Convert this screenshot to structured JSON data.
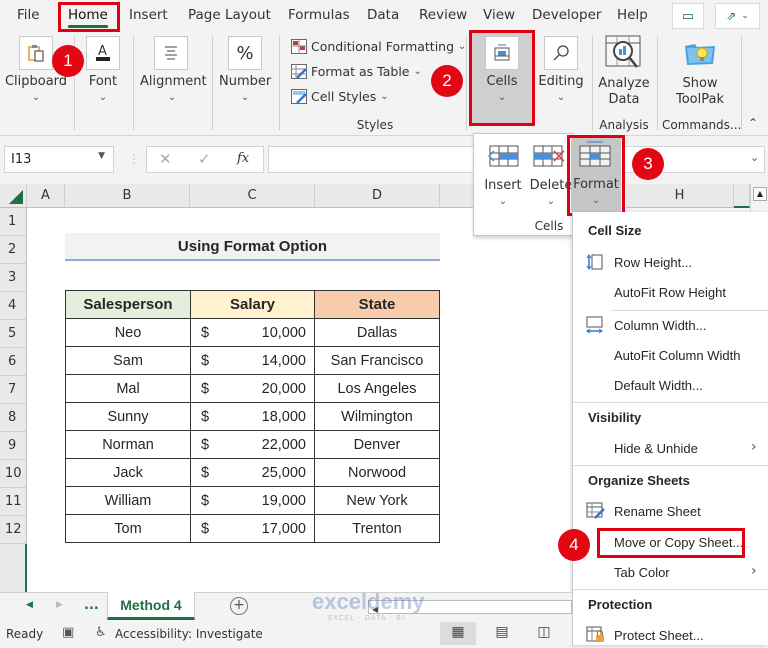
{
  "menu": {
    "tabs": [
      "File",
      "Home",
      "Insert",
      "Page Layout",
      "Formulas",
      "Data",
      "Review",
      "View",
      "Developer",
      "Help"
    ],
    "active_tab": "Home"
  },
  "ribbon": {
    "clipboard": "Clipboard",
    "font": "Font",
    "alignment": "Alignment",
    "number": "Number",
    "conditional_formatting": "Conditional Formatting",
    "format_as_table": "Format as Table",
    "cell_styles": "Cell Styles",
    "styles_group": "Styles",
    "cells": "Cells",
    "editing": "Editing",
    "analyze_data_1": "Analyze",
    "analyze_data_2": "Data",
    "analysis_group": "Analysis",
    "show_toolpak_1": "Show",
    "show_toolpak_2": "ToolPak",
    "commands_group": "Commands..."
  },
  "formula_bar": {
    "name_box": "I13",
    "fx": "fx",
    "formula": ""
  },
  "columns": [
    "A",
    "B",
    "C",
    "D",
    "H"
  ],
  "rows": [
    "1",
    "2",
    "3",
    "4",
    "5",
    "6",
    "7",
    "8",
    "9",
    "10",
    "11",
    "12"
  ],
  "sheet": {
    "title": "Using Format Option",
    "headers": [
      "Salesperson",
      "Salary",
      "State"
    ],
    "header_colors": [
      "#e2efda",
      "#fff2cc",
      "#f8cbad"
    ],
    "records": [
      {
        "name": "Neo",
        "currency": "$",
        "salary": "10,000",
        "state": "Dallas"
      },
      {
        "name": "Sam",
        "currency": "$",
        "salary": "14,000",
        "state": "San Francisco"
      },
      {
        "name": "Mal",
        "currency": "$",
        "salary": "20,000",
        "state": "Los Angeles"
      },
      {
        "name": "Sunny",
        "currency": "$",
        "salary": "18,000",
        "state": "Wilmington"
      },
      {
        "name": "Norman",
        "currency": "$",
        "salary": "22,000",
        "state": "Denver"
      },
      {
        "name": "Jack",
        "currency": "$",
        "salary": "25,000",
        "state": "Norwood"
      },
      {
        "name": "William",
        "currency": "$",
        "salary": "19,000",
        "state": "New York"
      },
      {
        "name": "Tom",
        "currency": "$",
        "salary": "17,000",
        "state": "Trenton"
      }
    ]
  },
  "cells_popup": {
    "insert": "Insert",
    "delete": "Delete",
    "format": "Format",
    "group": "Cells"
  },
  "format_menu": {
    "cell_size": "Cell Size",
    "row_height": "Row Height...",
    "autofit_row_height": "AutoFit Row Height",
    "column_width": "Column Width...",
    "autofit_column_width": "AutoFit Column Width",
    "default_width": "Default Width...",
    "visibility": "Visibility",
    "hide_unhide": "Hide & Unhide",
    "organize_sheets": "Organize Sheets",
    "rename_sheet": "Rename Sheet",
    "move_copy_sheet": "Move or Copy Sheet...",
    "tab_color": "Tab Color",
    "protection": "Protection",
    "protect_sheet": "Protect Sheet..."
  },
  "badges": [
    "1",
    "2",
    "3",
    "4"
  ],
  "sheet_tabs": {
    "ellipsis": "...",
    "active": "Method 4"
  },
  "status": {
    "ready": "Ready",
    "accessibility": "Accessibility: Investigate"
  },
  "watermark": {
    "brand": "exceldemy",
    "tagline": "EXCEL · DATA · BI"
  }
}
